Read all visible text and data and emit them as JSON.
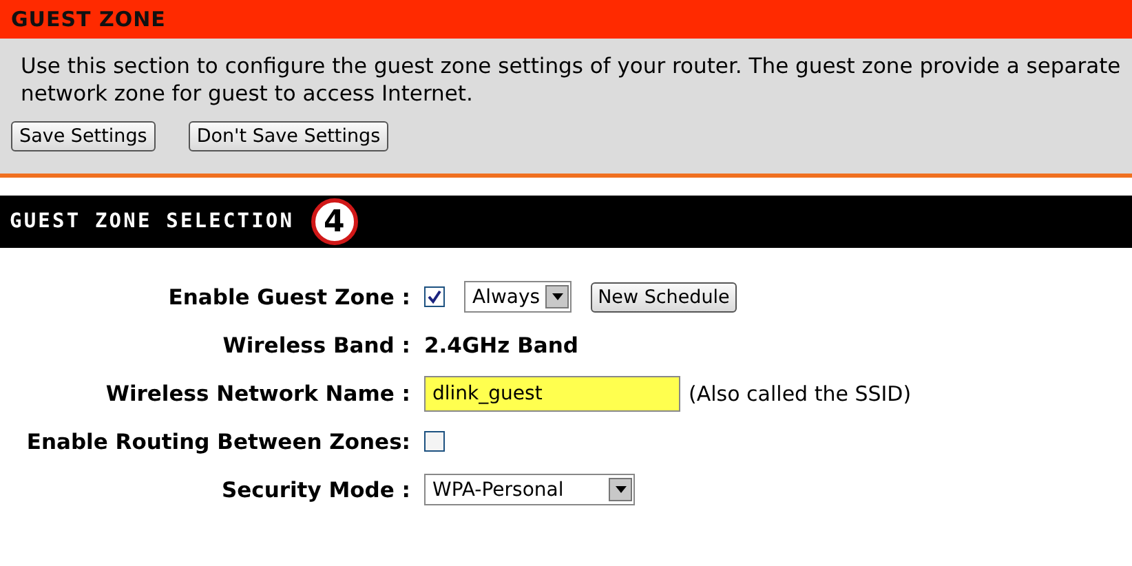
{
  "header": {
    "title": "GUEST ZONE"
  },
  "intro": {
    "text": "Use this section to configure the guest zone settings of your router. The guest zone provide a separate network zone for guest to access Internet.",
    "buttons": [
      "Save Settings",
      "Don't Save Settings"
    ]
  },
  "section": {
    "title": "GUEST ZONE SELECTION",
    "step_badge": "4"
  },
  "rows": [
    {
      "kind": "schedule",
      "label": "Enable Guest Zone :",
      "checked": true,
      "select": "Always",
      "button": "New Schedule"
    },
    {
      "kind": "text",
      "label": "Wireless Band :",
      "value": "2.4GHz Band"
    },
    {
      "kind": "input",
      "label": "Wireless Network Name :",
      "value": "dlink_guest",
      "note": "(Also called the SSID)"
    },
    {
      "kind": "checkbox",
      "label": "Enable Routing Between Zones:",
      "checked": false
    },
    {
      "kind": "select",
      "label": "Security Mode :",
      "select": "WPA-Personal"
    }
  ]
}
